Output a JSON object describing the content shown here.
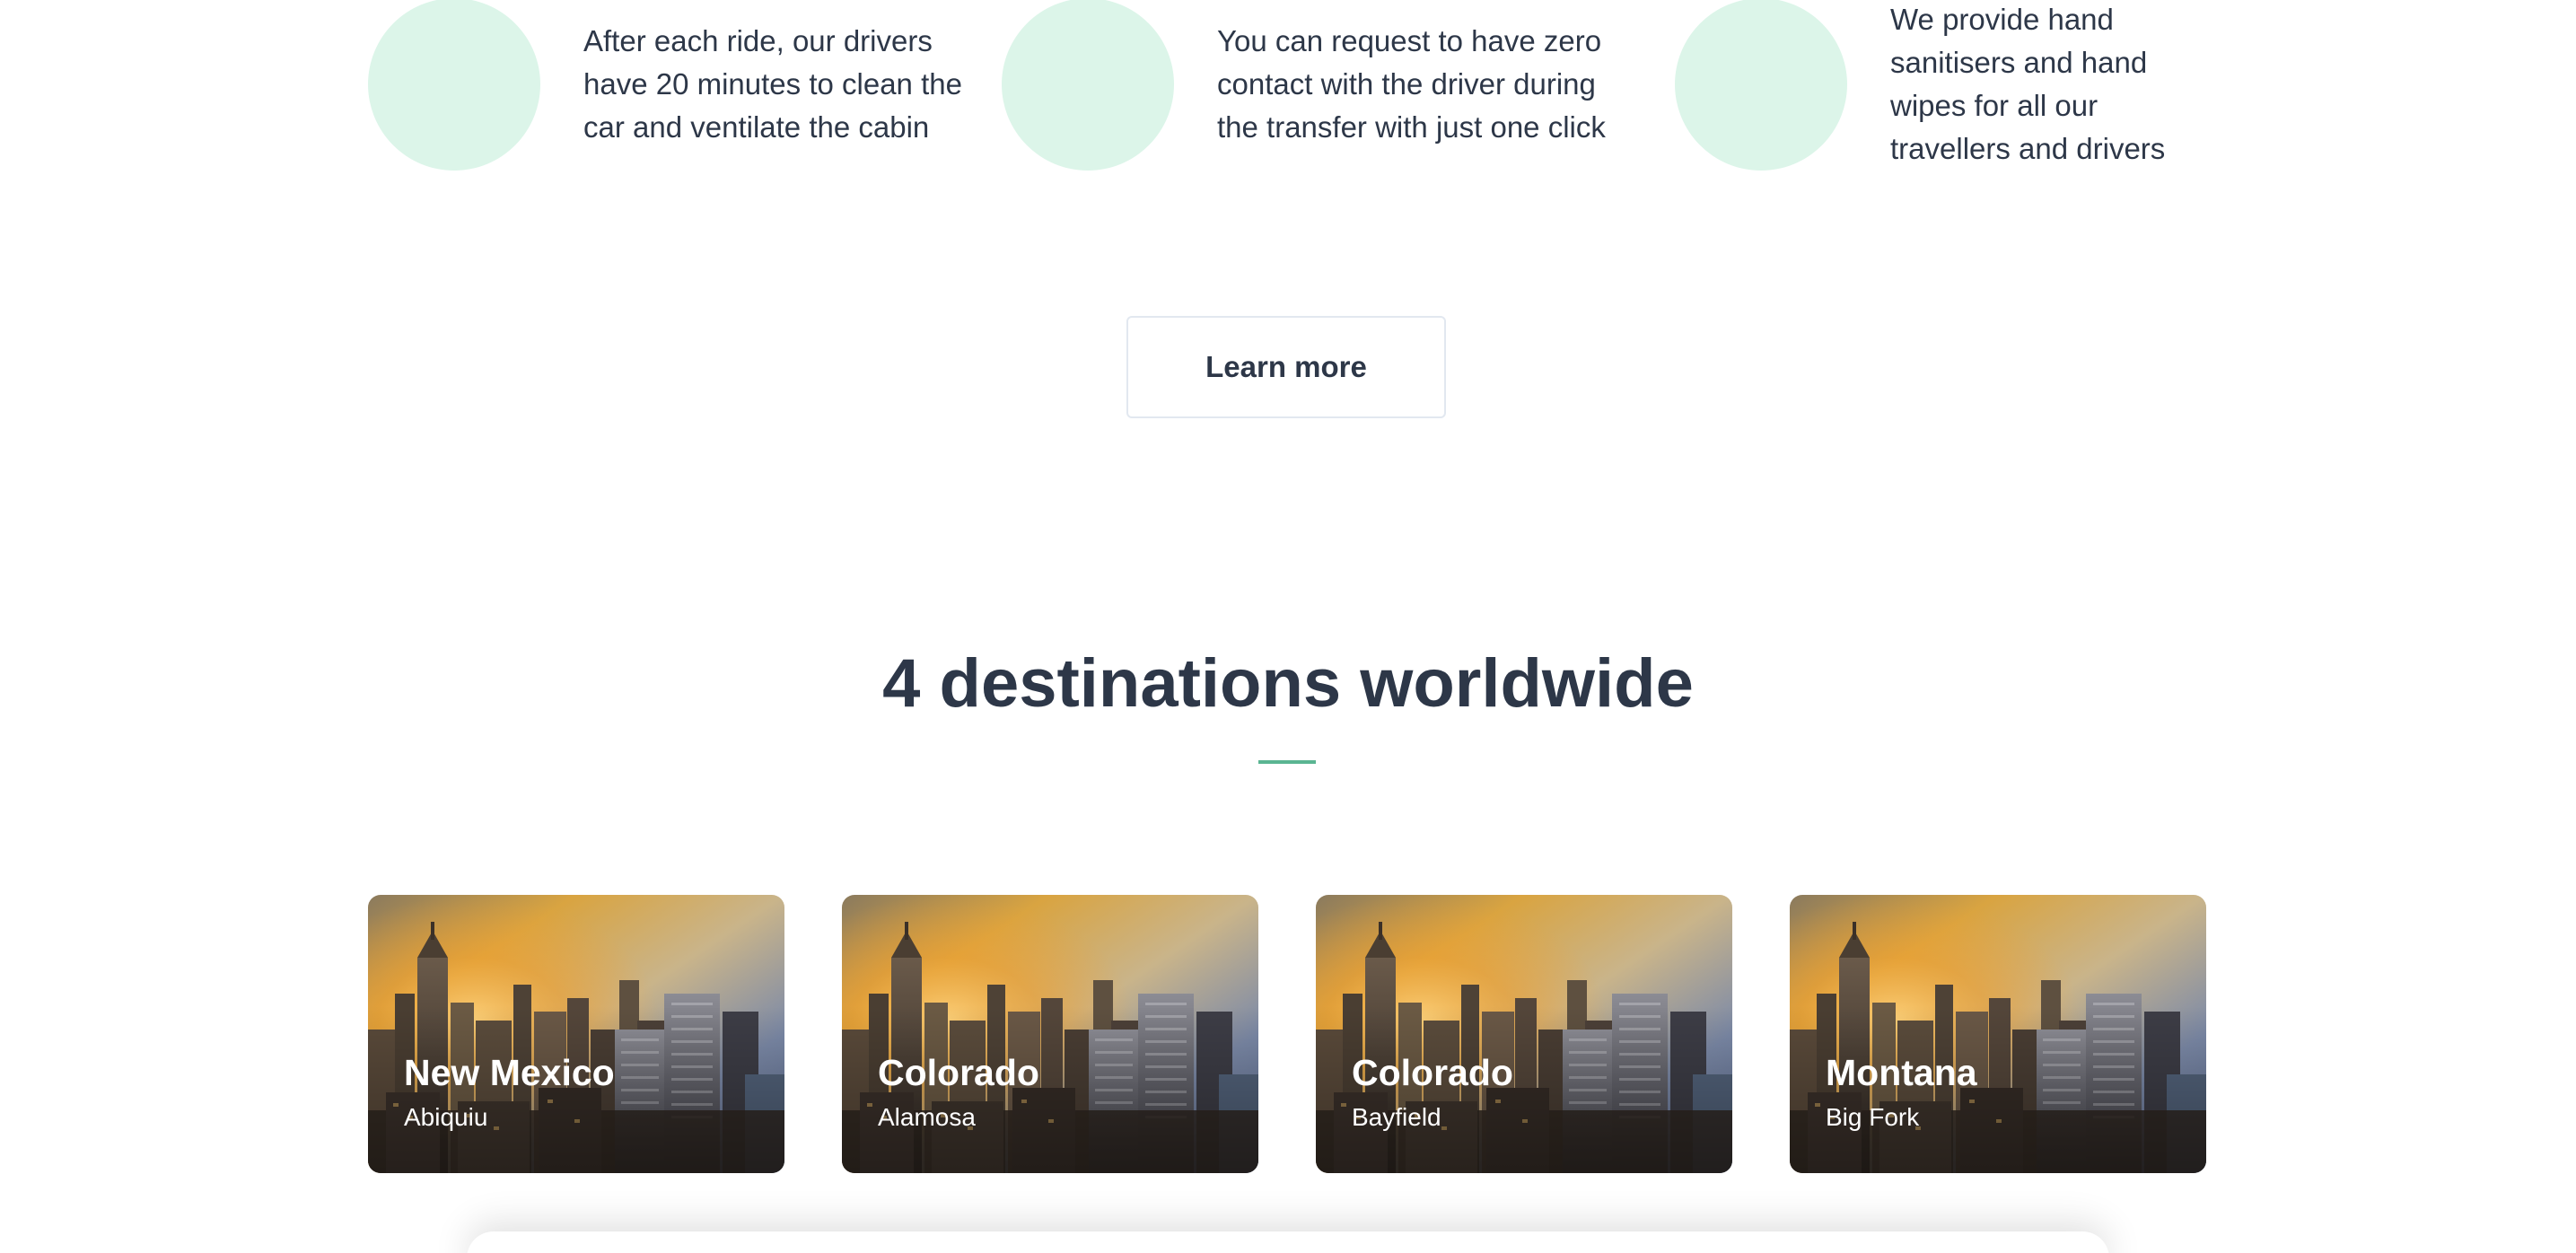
{
  "features": [
    {
      "text": "After each ride, our drivers\nhave 20 minutes to clean the\ncar and ventilate the cabin"
    },
    {
      "text": "You can request to have zero\ncontact with the driver during\nthe transfer with just one click"
    },
    {
      "text": "We provide hand\nsanitisers and hand\nwipes for all our\ntravellers and drivers"
    }
  ],
  "learn_more_label": "Learn more",
  "destinations": {
    "title": "4 destinations worldwide",
    "accent_color": "#5ab592",
    "items": [
      {
        "state": "New Mexico",
        "city": "Abiquiu"
      },
      {
        "state": "Colorado",
        "city": "Alamosa"
      },
      {
        "state": "Colorado",
        "city": "Bayfield"
      },
      {
        "state": "Montana",
        "city": "Big Fork"
      }
    ]
  }
}
